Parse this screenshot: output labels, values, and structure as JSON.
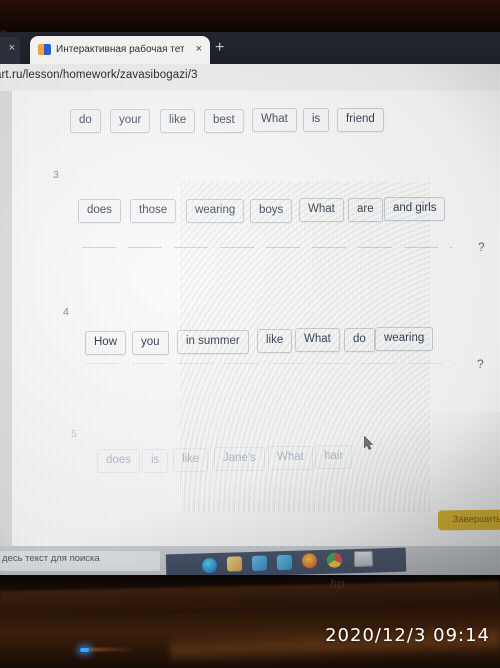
{
  "browser": {
    "partial_tab_close": "×",
    "active_tab": {
      "title": "Интерактивная рабочая тетрадь",
      "close": "×",
      "favicon": "skysmart-favicon"
    },
    "new_tab": "+",
    "url": "art.ru/lesson/homework/zavasibogazi/3"
  },
  "worksheet": {
    "questions": [
      {
        "number": "",
        "faded": false,
        "words": [
          "do",
          "your",
          "like",
          "best",
          "What",
          "is",
          "friend"
        ],
        "has_line": false,
        "question_mark": ""
      },
      {
        "number": "3",
        "faded": false,
        "words": [
          "does",
          "those",
          "wearing",
          "boys",
          "What",
          "are",
          "and girls"
        ],
        "has_line": true,
        "question_mark": "?"
      },
      {
        "number": "4",
        "faded": false,
        "words": [
          "How",
          "you",
          "in summer",
          "like",
          "What",
          "do",
          "wearing"
        ],
        "has_line": true,
        "question_mark": "?"
      },
      {
        "number": "5",
        "faded": true,
        "words": [
          "does",
          "is",
          "like",
          "Jane's",
          "What",
          "hair"
        ],
        "has_line": false,
        "question_mark": ""
      }
    ],
    "back_arrow": "←",
    "finish_button": "Завершить"
  },
  "taskbar": {
    "search_placeholder": "десь текст для поиска",
    "icons": [
      "task-view-icon",
      "edge-icon",
      "store-icon",
      "file-explorer-icon",
      "mail-icon",
      "firefox-icon",
      "chrome-icon",
      "photos-icon"
    ]
  },
  "device": {
    "brand": "hp",
    "power_led": "led-indicator"
  },
  "overlay": {
    "timestamp": "2020/12/3  09:14"
  },
  "colors": {
    "chip_text": "#24324a",
    "accent_yellow": "#ddb114",
    "back_arrow": "#2fa3bd",
    "timestamp": "#ffffff"
  }
}
